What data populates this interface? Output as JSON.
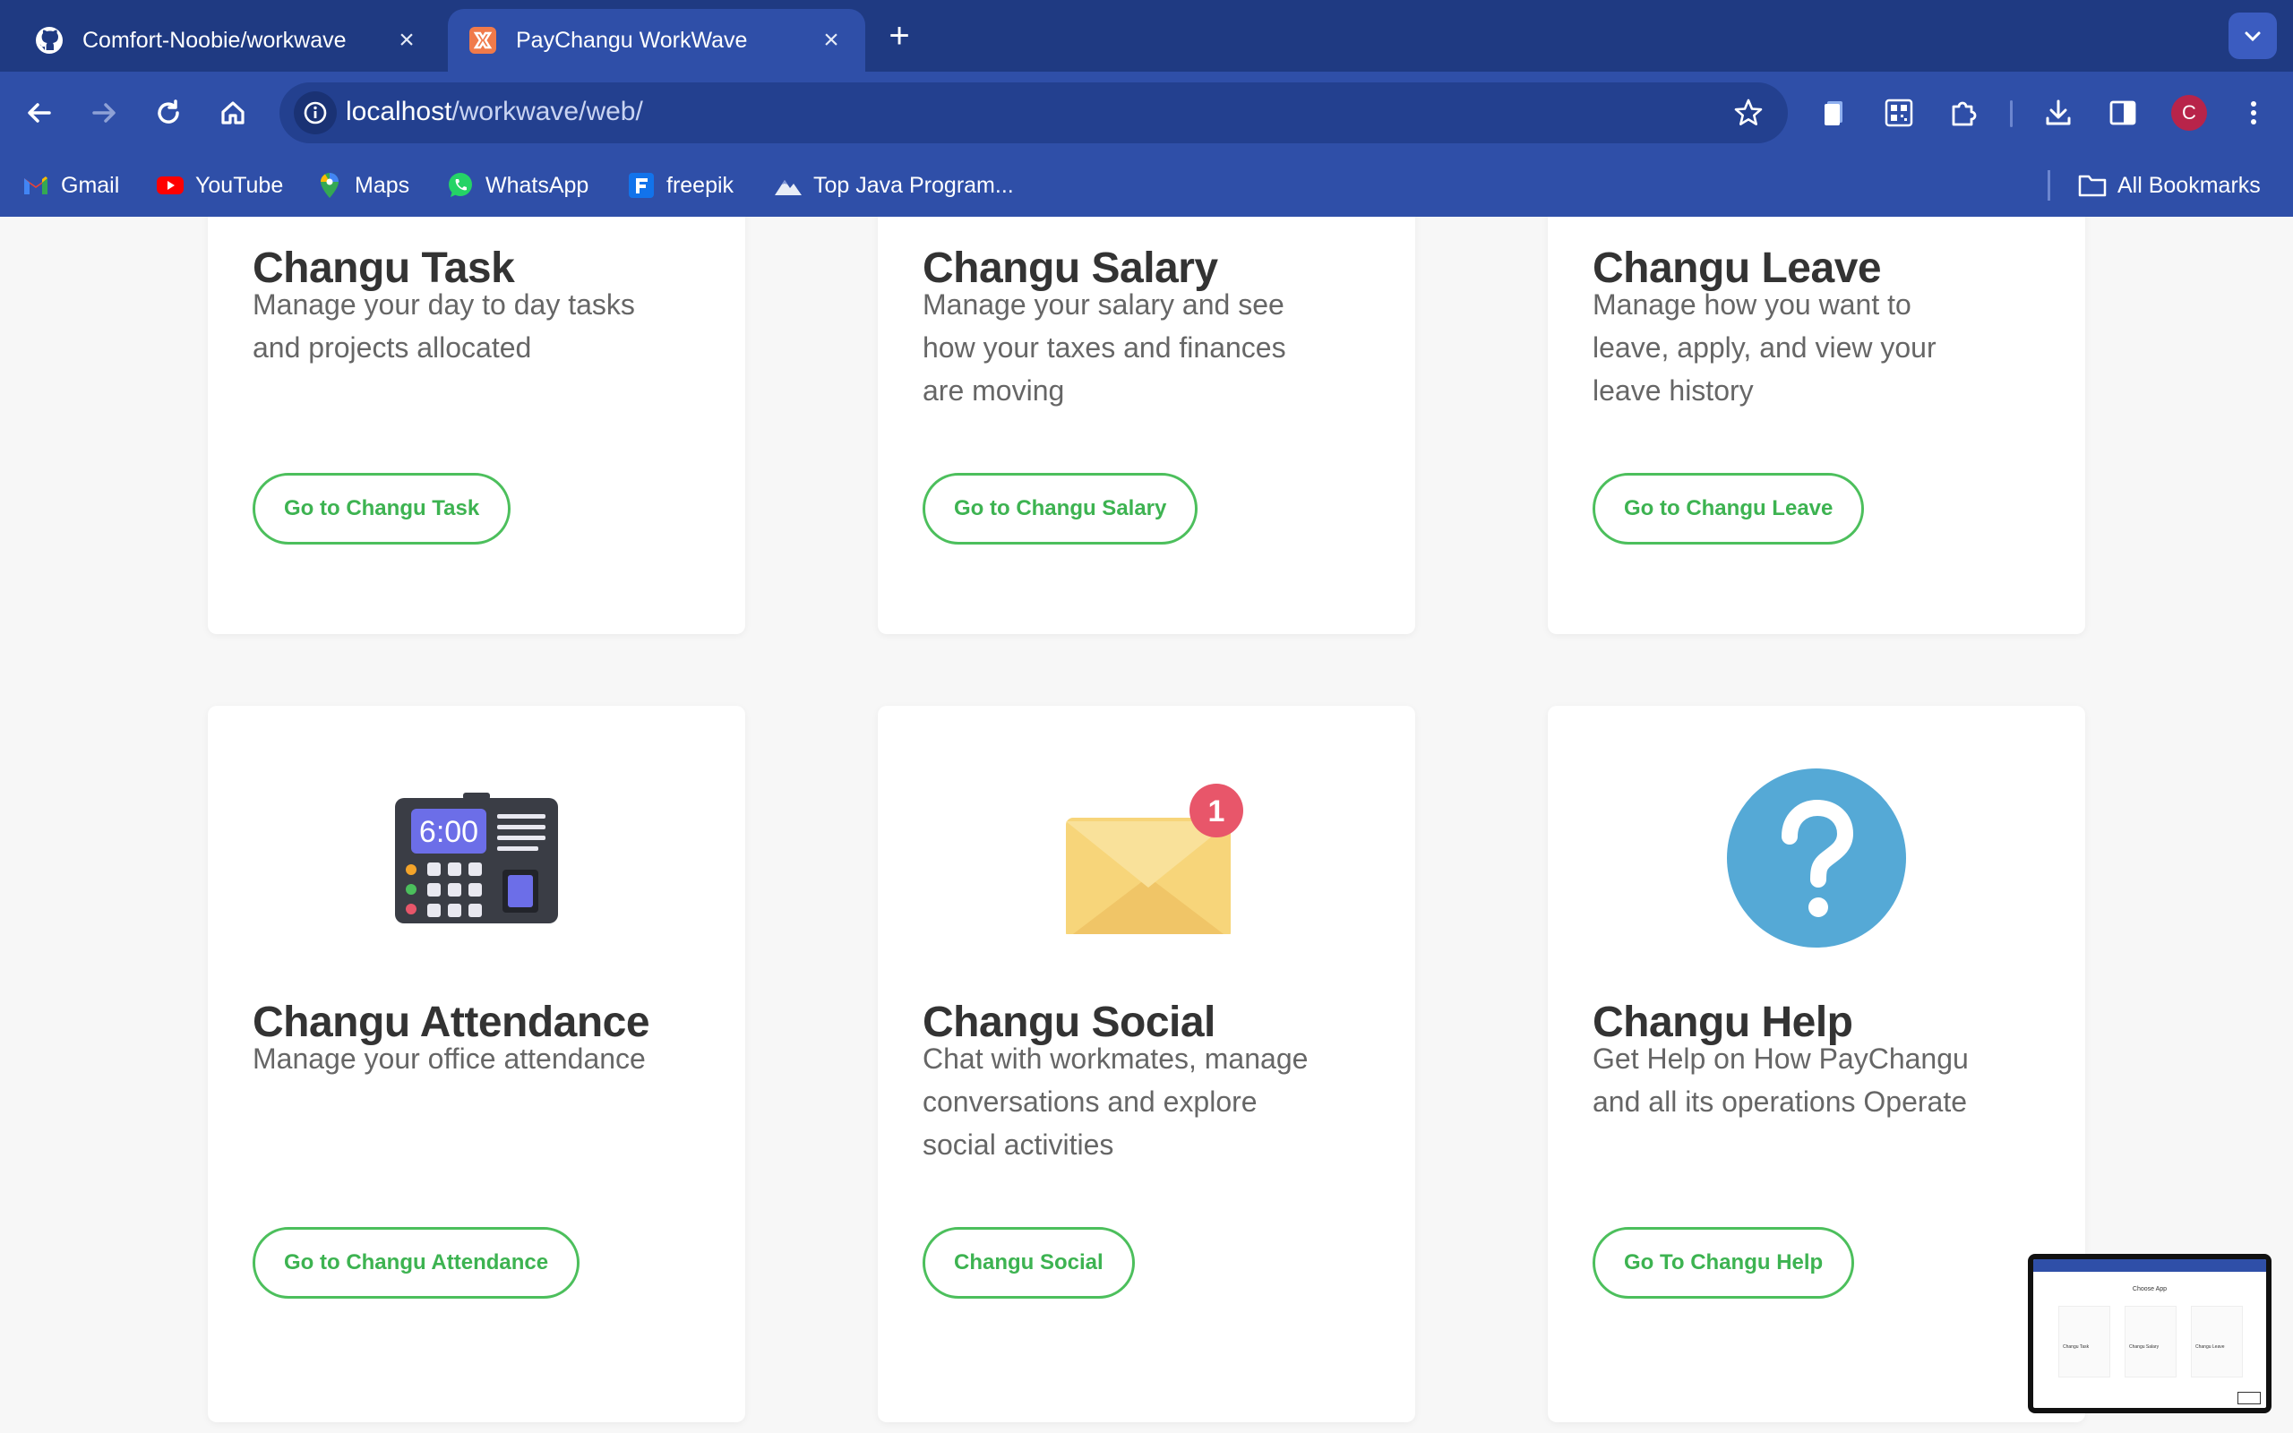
{
  "browser": {
    "tabs": [
      {
        "title": "Comfort-Noobie/workwave",
        "icon": "github-icon",
        "active": false
      },
      {
        "title": "PayChangu WorkWave",
        "icon": "xampp-icon",
        "active": true
      }
    ],
    "url_host": "localhost",
    "url_path": "/workwave/web/",
    "profile_initial": "C",
    "bookmarks": [
      {
        "label": "Gmail",
        "icon": "gmail-icon"
      },
      {
        "label": "YouTube",
        "icon": "youtube-icon"
      },
      {
        "label": "Maps",
        "icon": "maps-icon"
      },
      {
        "label": "WhatsApp",
        "icon": "whatsapp-icon"
      },
      {
        "label": "freepik",
        "icon": "freepik-icon"
      },
      {
        "label": "Top Java Program...",
        "icon": "mountain-icon"
      }
    ],
    "all_bookmarks_label": "All Bookmarks"
  },
  "cards": [
    {
      "title": "Changu Task",
      "description": "Manage your day to day tasks and projects allocated",
      "button": "Go to Changu Task"
    },
    {
      "title": "Changu Salary",
      "description": "Manage your salary and see how your taxes and finances are moving",
      "button": "Go to Changu Salary"
    },
    {
      "title": "Changu Leave",
      "description": "Manage how you want to leave, apply, and view your leave history",
      "button": "Go to Changu Leave"
    },
    {
      "title": "Changu Attendance",
      "description": "Manage your office attendance",
      "button": "Go to Changu Attendance",
      "illustration": "time-clock-icon",
      "clock_display": "6:00"
    },
    {
      "title": "Changu Social",
      "description": "Chat with workmates, manage conversations and explore social activities",
      "button": "Changu Social",
      "illustration": "envelope-icon",
      "notification_count": "1"
    },
    {
      "title": "Changu Help",
      "description": "Get Help on How PayChangu and all its operations Operate",
      "button": "Go To Changu Help",
      "illustration": "question-mark-icon"
    }
  ],
  "thumbnail": {
    "heading": "Choose App",
    "items": [
      "Changu Task",
      "Changu Salary",
      "Changu Leave"
    ]
  },
  "colors": {
    "chrome_dark": "#1f3a82",
    "chrome": "#2f4fa8",
    "accent_green": "#4cbf5c",
    "help_blue": "#55a9d6",
    "envelope_yellow": "#f7d57a",
    "badge_red": "#e8566a"
  }
}
